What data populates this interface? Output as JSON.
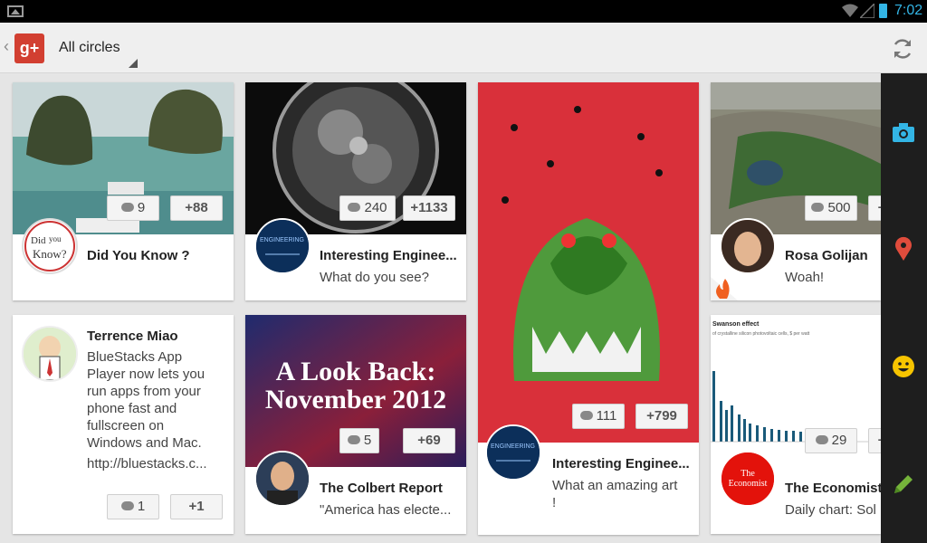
{
  "status": {
    "time": "7:02"
  },
  "header": {
    "circles_label": "All circles",
    "logo_text": "g+"
  },
  "cards": [
    {
      "id": "c1",
      "name": "Did You Know ?",
      "comments": "9",
      "plusones": "+88",
      "avatar_text": "Did you Know?"
    },
    {
      "id": "c2",
      "name": "Interesting Enginee...",
      "snippet": "What do you see?",
      "comments": "240",
      "plusones": "+1133"
    },
    {
      "id": "c3",
      "name": "Interesting Enginee...",
      "snippet": "What an amazing art",
      "snippet2": "!",
      "comments": "111",
      "plusones": "+799"
    },
    {
      "id": "c4",
      "name": "Rosa Golijan",
      "snippet": "Woah!",
      "comments": "500",
      "plusones": "+"
    },
    {
      "id": "c5",
      "name": "Terrence Miao",
      "snippet_lines": [
        "BlueStacks App",
        "Player now lets you",
        "run apps from your",
        "phone fast and",
        "fullscreen on",
        "Windows and Mac."
      ],
      "link": "http://bluestacks.c...",
      "comments": "1",
      "plusones": "+1"
    },
    {
      "id": "c6",
      "name": "The Colbert Report",
      "snippet": "\"America has electe...",
      "comments": "5",
      "plusones": "+69",
      "image_title_1": "A Look Back:",
      "image_title_2": "November 2012"
    },
    {
      "id": "c7",
      "name": "The Economist",
      "snippet": "Daily chart: Sol",
      "comments": "29",
      "plusones": "+",
      "chart_title": "Swanson effect",
      "chart_sub": "of crystalline silicon photovoltaic cells, $ per watt",
      "avatar_text": "The Economist"
    }
  ],
  "colors": {
    "accent": "#33b5e5",
    "gplus_red": "#d23f31",
    "camera_blue": "#33b5e5",
    "pin_red": "#e04c3c",
    "smile_yellow": "#f7c400",
    "pencil_green": "#75b43a"
  }
}
